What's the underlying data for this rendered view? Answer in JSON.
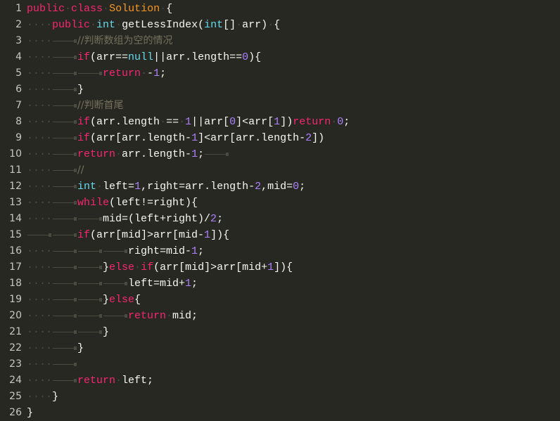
{
  "editor": {
    "theme": {
      "background": "#272822",
      "keyword": "#f92672",
      "type": "#66d9ef",
      "class_name": "#fd971f",
      "number": "#ae81ff",
      "comment": "#75715e",
      "text": "#f8f8f2",
      "whitespace_marker": "#4a4a40"
    },
    "lines": [
      {
        "n": "1",
        "tokens": [
          [
            "kw",
            "public"
          ],
          [
            "sp",
            "·"
          ],
          [
            "kw",
            "class"
          ],
          [
            "sp",
            "·"
          ],
          [
            "cls",
            "Solution"
          ],
          [
            "sp",
            "·"
          ],
          [
            "txt",
            "{"
          ]
        ]
      },
      {
        "n": "2",
        "tokens": [
          [
            "sp",
            "····"
          ],
          [
            "kw",
            "public"
          ],
          [
            "sp",
            "·"
          ],
          [
            "type",
            "int"
          ],
          [
            "sp",
            "·"
          ],
          [
            "fn",
            "getLessIndex"
          ],
          [
            "txt",
            "("
          ],
          [
            "type",
            "int"
          ],
          [
            "txt",
            "[]"
          ],
          [
            "sp",
            "·"
          ],
          [
            "txt",
            "arr)"
          ],
          [
            "sp",
            "·"
          ],
          [
            "txt",
            "{"
          ]
        ]
      },
      {
        "n": "3",
        "tokens": [
          [
            "sp",
            "····"
          ],
          [
            "tab",
            ""
          ],
          [
            "com",
            "//判断数组为空的情况"
          ]
        ]
      },
      {
        "n": "4",
        "tokens": [
          [
            "sp",
            "····"
          ],
          [
            "tab",
            ""
          ],
          [
            "kw",
            "if"
          ],
          [
            "txt",
            "(arr=="
          ],
          [
            "type",
            "null"
          ],
          [
            "txt",
            "||arr.length=="
          ],
          [
            "num",
            "0"
          ],
          [
            "txt",
            "){"
          ]
        ]
      },
      {
        "n": "5",
        "tokens": [
          [
            "sp",
            "····"
          ],
          [
            "tab",
            ""
          ],
          [
            "tab",
            ""
          ],
          [
            "kw",
            "return"
          ],
          [
            "sp",
            "·"
          ],
          [
            "txt",
            "-"
          ],
          [
            "num",
            "1"
          ],
          [
            "txt",
            ";"
          ]
        ]
      },
      {
        "n": "6",
        "tokens": [
          [
            "sp",
            "····"
          ],
          [
            "tab",
            ""
          ],
          [
            "txt",
            "}"
          ]
        ]
      },
      {
        "n": "7",
        "tokens": [
          [
            "sp",
            "····"
          ],
          [
            "tab",
            ""
          ],
          [
            "com",
            "//判断首尾"
          ]
        ]
      },
      {
        "n": "8",
        "tokens": [
          [
            "sp",
            "····"
          ],
          [
            "tab",
            ""
          ],
          [
            "kw",
            "if"
          ],
          [
            "txt",
            "(arr.length"
          ],
          [
            "sp",
            "·"
          ],
          [
            "txt",
            "=="
          ],
          [
            "sp",
            "·"
          ],
          [
            "num",
            "1"
          ],
          [
            "txt",
            "||arr["
          ],
          [
            "num",
            "0"
          ],
          [
            "txt",
            "]<arr["
          ],
          [
            "num",
            "1"
          ],
          [
            "txt",
            "])"
          ],
          [
            "kw",
            "return"
          ],
          [
            "sp",
            "·"
          ],
          [
            "num",
            "0"
          ],
          [
            "txt",
            ";"
          ]
        ]
      },
      {
        "n": "9",
        "tokens": [
          [
            "sp",
            "····"
          ],
          [
            "tab",
            ""
          ],
          [
            "kw",
            "if"
          ],
          [
            "txt",
            "(arr[arr.length-"
          ],
          [
            "num",
            "1"
          ],
          [
            "txt",
            "]<arr[arr.length-"
          ],
          [
            "num",
            "2"
          ],
          [
            "txt",
            "])"
          ]
        ]
      },
      {
        "n": "10",
        "tokens": [
          [
            "sp",
            "····"
          ],
          [
            "tab",
            ""
          ],
          [
            "kw",
            "return"
          ],
          [
            "sp",
            "·"
          ],
          [
            "txt",
            "arr.length-"
          ],
          [
            "num",
            "1"
          ],
          [
            "txt",
            ";"
          ],
          [
            "tab",
            ""
          ]
        ]
      },
      {
        "n": "11",
        "tokens": [
          [
            "sp",
            "····"
          ],
          [
            "tab",
            ""
          ],
          [
            "com",
            "//"
          ]
        ]
      },
      {
        "n": "12",
        "tokens": [
          [
            "sp",
            "····"
          ],
          [
            "tab",
            ""
          ],
          [
            "type",
            "int"
          ],
          [
            "sp",
            "·"
          ],
          [
            "txt",
            "left="
          ],
          [
            "num",
            "1"
          ],
          [
            "txt",
            ",right=arr.length-"
          ],
          [
            "num",
            "2"
          ],
          [
            "txt",
            ",mid="
          ],
          [
            "num",
            "0"
          ],
          [
            "txt",
            ";"
          ]
        ]
      },
      {
        "n": "13",
        "tokens": [
          [
            "sp",
            "····"
          ],
          [
            "tab",
            ""
          ],
          [
            "kw",
            "while"
          ],
          [
            "txt",
            "(left!=right){"
          ]
        ]
      },
      {
        "n": "14",
        "tokens": [
          [
            "sp",
            "····"
          ],
          [
            "tab",
            ""
          ],
          [
            "tab",
            ""
          ],
          [
            "txt",
            "mid=(left+right)/"
          ],
          [
            "num",
            "2"
          ],
          [
            "txt",
            ";"
          ]
        ]
      },
      {
        "n": "15",
        "tokens": [
          [
            "tab",
            ""
          ],
          [
            "tab",
            ""
          ],
          [
            "kw",
            "if"
          ],
          [
            "txt",
            "(arr[mid]>arr[mid-"
          ],
          [
            "num",
            "1"
          ],
          [
            "txt",
            "]){"
          ]
        ]
      },
      {
        "n": "16",
        "tokens": [
          [
            "sp",
            "····"
          ],
          [
            "tab",
            ""
          ],
          [
            "tab",
            ""
          ],
          [
            "tab",
            ""
          ],
          [
            "txt",
            "right=mid-"
          ],
          [
            "num",
            "1"
          ],
          [
            "txt",
            ";"
          ]
        ]
      },
      {
        "n": "17",
        "tokens": [
          [
            "sp",
            "····"
          ],
          [
            "tab",
            ""
          ],
          [
            "tab",
            ""
          ],
          [
            "txt",
            "}"
          ],
          [
            "kw",
            "else"
          ],
          [
            "sp",
            "·"
          ],
          [
            "kw",
            "if"
          ],
          [
            "txt",
            "(arr[mid]>arr[mid+"
          ],
          [
            "num",
            "1"
          ],
          [
            "txt",
            "]){"
          ]
        ]
      },
      {
        "n": "18",
        "tokens": [
          [
            "sp",
            "····"
          ],
          [
            "tab",
            ""
          ],
          [
            "tab",
            ""
          ],
          [
            "tab",
            ""
          ],
          [
            "txt",
            "left=mid+"
          ],
          [
            "num",
            "1"
          ],
          [
            "txt",
            ";"
          ]
        ]
      },
      {
        "n": "19",
        "tokens": [
          [
            "sp",
            "····"
          ],
          [
            "tab",
            ""
          ],
          [
            "tab",
            ""
          ],
          [
            "txt",
            "}"
          ],
          [
            "kw",
            "else"
          ],
          [
            "txt",
            "{"
          ]
        ]
      },
      {
        "n": "20",
        "tokens": [
          [
            "sp",
            "····"
          ],
          [
            "tab",
            ""
          ],
          [
            "tab",
            ""
          ],
          [
            "tab",
            ""
          ],
          [
            "kw",
            "return"
          ],
          [
            "sp",
            "·"
          ],
          [
            "txt",
            "mid;"
          ]
        ]
      },
      {
        "n": "21",
        "tokens": [
          [
            "sp",
            "····"
          ],
          [
            "tab",
            ""
          ],
          [
            "tab",
            ""
          ],
          [
            "txt",
            "}"
          ]
        ]
      },
      {
        "n": "22",
        "tokens": [
          [
            "sp",
            "····"
          ],
          [
            "tab",
            ""
          ],
          [
            "txt",
            "}"
          ]
        ]
      },
      {
        "n": "23",
        "tokens": [
          [
            "sp",
            "····"
          ],
          [
            "tab",
            ""
          ]
        ]
      },
      {
        "n": "24",
        "tokens": [
          [
            "sp",
            "····"
          ],
          [
            "tab",
            ""
          ],
          [
            "kw",
            "return"
          ],
          [
            "sp",
            "·"
          ],
          [
            "txt",
            "left;"
          ]
        ]
      },
      {
        "n": "25",
        "tokens": [
          [
            "sp",
            "····"
          ],
          [
            "txt",
            "}"
          ]
        ]
      },
      {
        "n": "26",
        "tokens": [
          [
            "txt",
            "}"
          ]
        ]
      }
    ]
  }
}
